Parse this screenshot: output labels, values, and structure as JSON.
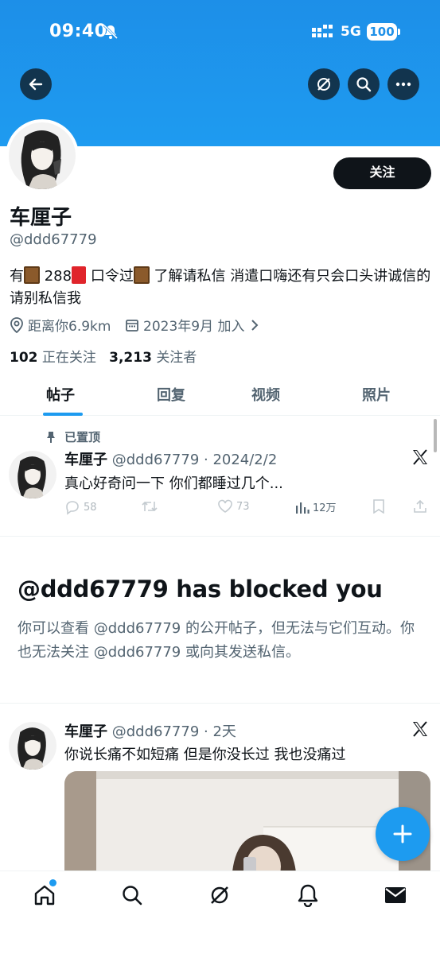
{
  "status_bar": {
    "time": "09:40",
    "network": "5G",
    "battery": "100"
  },
  "profile": {
    "display_name": "车厘子",
    "handle": "@ddd67779",
    "bio_part1": "有",
    "bio_part2": "288",
    "bio_part3": " 口令过",
    "bio_part4": " 了解请私信 消遣口嗨还有只会口头讲诚信的请别私信我",
    "location": "距离你6.9km",
    "joined": "2023年9月 加入",
    "following_count": "102",
    "following_label": "正在关注",
    "followers_count": "3,213",
    "followers_label": "关注者",
    "follow_button": "关注"
  },
  "tabs": [
    {
      "label": "帖子",
      "active": true
    },
    {
      "label": "回复",
      "active": false
    },
    {
      "label": "视频",
      "active": false
    },
    {
      "label": "照片",
      "active": false
    }
  ],
  "pinned_post": {
    "pinned_label": "已置顶",
    "name": "车厘子",
    "handle_date": "@ddd67779 · 2024/2/2",
    "text": "真心好奇问一下 你们都睡过几个...",
    "replies": "58",
    "likes": "73",
    "views": "12万"
  },
  "blocked": {
    "title": "@ddd67779 has blocked you",
    "description": "你可以查看 @ddd67779 的公开帖子，但无法与它们互动。你也无法关注 @ddd67779 或向其发送私信。"
  },
  "second_post": {
    "name": "车厘子",
    "handle_date": "@ddd67779 · 2天",
    "text": "你说长痛不如短痛 但是你没长过 我也没痛过"
  },
  "colors": {
    "accent": "#1d9bf0",
    "banner": "#1e9bf0",
    "text": "#0f1419",
    "secondary": "#536471"
  }
}
